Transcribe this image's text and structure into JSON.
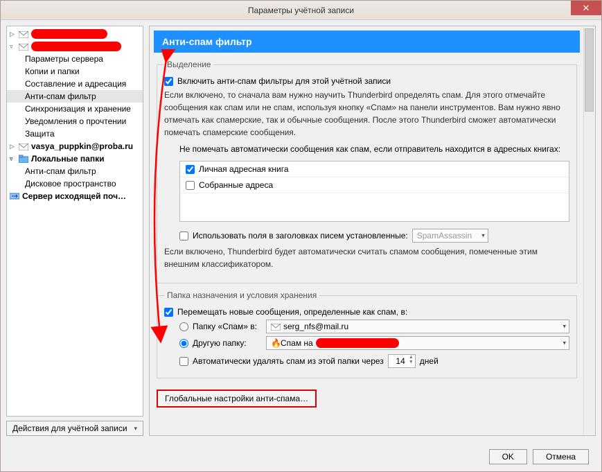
{
  "window": {
    "title": "Параметры учётной записи"
  },
  "sidebar": {
    "actions_label": "Действия для учётной записи",
    "items": [
      {
        "type": "account-redacted"
      },
      {
        "type": "account-redacted"
      },
      {
        "label": "Параметры сервера"
      },
      {
        "label": "Копии и папки"
      },
      {
        "label": "Составление и адресация"
      },
      {
        "label": "Анти-спам фильтр",
        "selected": true
      },
      {
        "label": "Синхронизация и хранение"
      },
      {
        "label": "Уведомления о прочтении"
      },
      {
        "label": "Защита"
      },
      {
        "label": "vasya_puppkin@proba.ru",
        "type": "account"
      },
      {
        "label": "Локальные папки",
        "type": "local",
        "bold": true
      },
      {
        "label": "Анти-спам фильтр"
      },
      {
        "label": "Дисковое пространство"
      },
      {
        "label": "Сервер исходящей поч…",
        "type": "smtp",
        "bold": true
      }
    ]
  },
  "pane": {
    "title": "Анти-спам фильтр",
    "group_selection": "Выделение",
    "enable_label": "Включить анти-спам фильтры для этой учётной записи",
    "enable_desc": "Если включено, то сначала вам нужно научить Thunderbird определять спам. Для этого отмечайте сообщения как спам или не спам, используя кнопку «Спам» на панели инструментов. Вам нужно явно отмечать как спамерские, так и обычные сообщения. После этого Thunderbird сможет автоматически помечать спамерские сообщения.",
    "whitelist_label": "Не помечать автоматически сообщения как спам, если отправитель находится в адресных книгах:",
    "whitelist_items": [
      {
        "label": "Личная адресная книга",
        "checked": true
      },
      {
        "label": "Собранные адреса",
        "checked": false
      }
    ],
    "headers_label": "Использовать поля в заголовках писем установленные:",
    "headers_value": "SpamAssassin",
    "headers_desc": "Если включено, Thunderbird будет автоматически считать спамом сообщения, помеченные этим внешним классификатором.",
    "group_dest": "Папка назначения и условия хранения",
    "move_label": "Перемещать новые сообщения, определенные как спам, в:",
    "radio_spam_folder": "Папку «Спам» в:",
    "spam_account": "serg_nfs@mail.ru",
    "radio_other": "Другую папку:",
    "other_folder_prefix": "Спам на",
    "autodelete_label": "Автоматически удалять спам из этой папки через",
    "autodelete_days": "14",
    "autodelete_suffix": "дней",
    "global_button": "Глобальные настройки анти-спама…"
  },
  "footer": {
    "ok": "OK",
    "cancel": "Отмена"
  }
}
